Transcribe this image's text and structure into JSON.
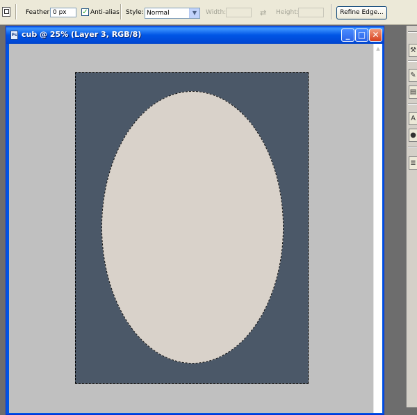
{
  "options_bar": {
    "feather_label": "Feather:",
    "feather_value": "0 px",
    "antialias_label": "Anti-alias",
    "antialias_checked": true,
    "style_label": "Style:",
    "style_value": "Normal",
    "width_label": "Width:",
    "height_label": "Height:",
    "refine_edge_label": "Refine Edge..."
  },
  "document_window": {
    "title": "cub @ 25% (Layer 3, RGB/8)",
    "doc_icon": "Ps",
    "minimize_glyph": "_",
    "maximize_glyph": "□",
    "close_glyph": "✕"
  },
  "canvas": {
    "background_color": "#4b5868",
    "oval_color": "#d9d2ca",
    "pasteboard_color": "#c0c0c0"
  },
  "right_panel": {
    "icons": [
      "tool-icon",
      "brush-icon",
      "layers-icon",
      "type-icon",
      "paint-icon",
      "paragraph-icon"
    ]
  }
}
